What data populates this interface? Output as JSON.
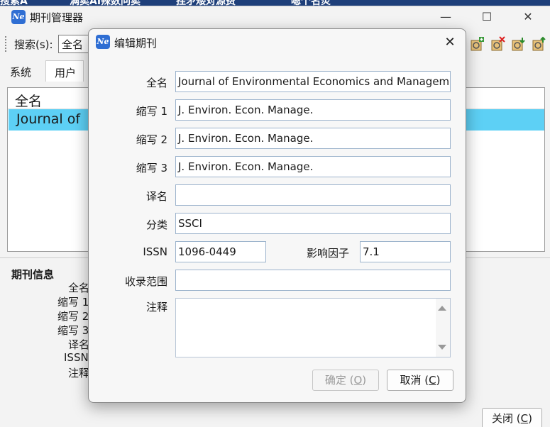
{
  "background_app": {
    "strip_texts": [
      "搜索A",
      "满卖AI辣数问卖",
      "挂矛矮对源费",
      "嗯个名炎"
    ]
  },
  "main_window": {
    "title": "期刊管理器",
    "controls": {
      "minimize": "—",
      "maximize": "☐",
      "close": "✕"
    },
    "toolbar": {
      "search_label": "搜索(s):",
      "search_value": "全名",
      "icons": [
        "add-journal-icon",
        "delete-journal-icon",
        "import-journal-icon",
        "export-journal-icon"
      ]
    },
    "tabs": [
      {
        "label": "系统",
        "active": false
      },
      {
        "label": "用户",
        "active": true
      }
    ],
    "list": {
      "header": "全名",
      "selected_row": "Journal of"
    },
    "info_panel": {
      "title": "期刊信息",
      "labels": [
        "全名",
        "缩写 1",
        "缩写 2",
        "缩写 3",
        "译名",
        "ISSN",
        "注释"
      ]
    },
    "close_button": {
      "label": "关闭 (",
      "key": "C",
      "suffix": ")"
    }
  },
  "dialog": {
    "title": "编辑期刊",
    "close_glyph": "✕",
    "fields": {
      "full_name": {
        "label": "全名",
        "value": "Journal of Environmental Economics and Managemen"
      },
      "abbr1": {
        "label": "缩写 1",
        "value": "J. Environ. Econ. Manage."
      },
      "abbr2": {
        "label": "缩写 2",
        "value": "J. Environ. Econ. Manage."
      },
      "abbr3": {
        "label": "缩写 3",
        "value": "J. Environ. Econ. Manage."
      },
      "translated_name": {
        "label": "译名",
        "value": ""
      },
      "category": {
        "label": "分类",
        "value": "SSCI"
      },
      "issn": {
        "label": "ISSN",
        "value": "1096-0449"
      },
      "impact_factor": {
        "label": "影响因子",
        "value": "7.1"
      },
      "coverage": {
        "label": "收录范围",
        "value": ""
      },
      "notes": {
        "label": "注释",
        "value": ""
      }
    },
    "ok_button": {
      "label": "确定 (",
      "key": "O",
      "suffix": ")"
    },
    "cancel_button": {
      "label": "取消 (",
      "key": "C",
      "suffix": ")"
    }
  },
  "colors": {
    "selection": "#5dd0f5",
    "app_icon": "#2f6ed3",
    "input_border": "#9cb3cc"
  }
}
